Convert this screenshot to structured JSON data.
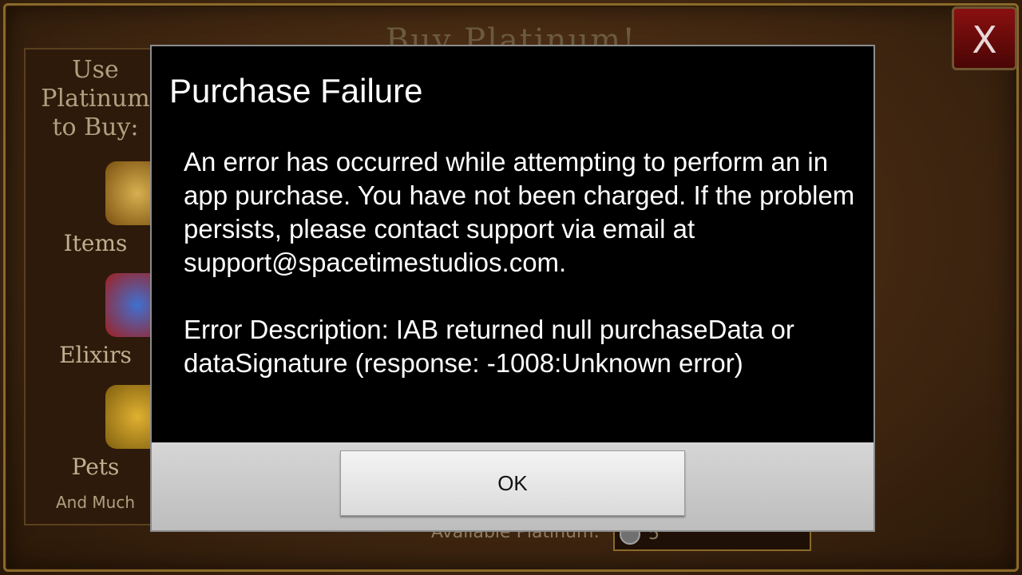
{
  "background": {
    "title": "Buy Platinum!",
    "close_label": "X",
    "left_panel": {
      "heading": "Use\nPlatinum\nto Buy:",
      "items": [
        "Items",
        "Elixirs",
        "Pets"
      ],
      "footer": "And Much"
    },
    "available_label": "Available Platinum:",
    "available_value": "5"
  },
  "dialog": {
    "title": "Purchase Failure",
    "message": "An error has occurred while attempting to perform an in app purchase.  You have not been charged.  If the problem persists, please contact support via email at support@spacetimestudios.com.",
    "error_description": "Error Description: IAB returned null purchaseData or dataSignature (response: -1008:Unknown error)",
    "ok_label": "OK"
  },
  "colors": {
    "dialog_bg": "#000000",
    "footer_bg": "#c8c8c8",
    "game_bg": "#3e2510"
  }
}
